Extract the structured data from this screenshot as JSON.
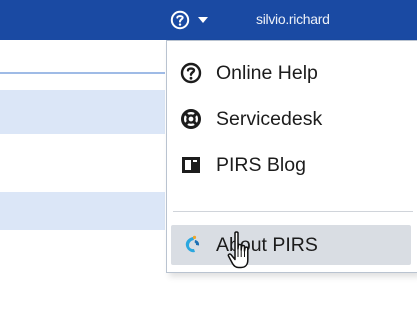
{
  "header": {
    "help_icon": "question-circle-icon",
    "dropdown_icon": "caret-down-icon",
    "username": "silvio.richard"
  },
  "help_menu": {
    "items": [
      {
        "label": "Online Help",
        "icon": "question-circle-icon"
      },
      {
        "label": "Servicedesk",
        "icon": "lifebuoy-icon"
      },
      {
        "label": "PIRS Blog",
        "icon": "blog-book-icon"
      },
      {
        "label": "About PIRS",
        "icon": "pirs-logo-icon",
        "hovered": true
      }
    ]
  },
  "colors": {
    "header_bg": "#1a4aa3",
    "hover_bg": "#d9dde3",
    "row_bg": "#dbe6f7"
  }
}
